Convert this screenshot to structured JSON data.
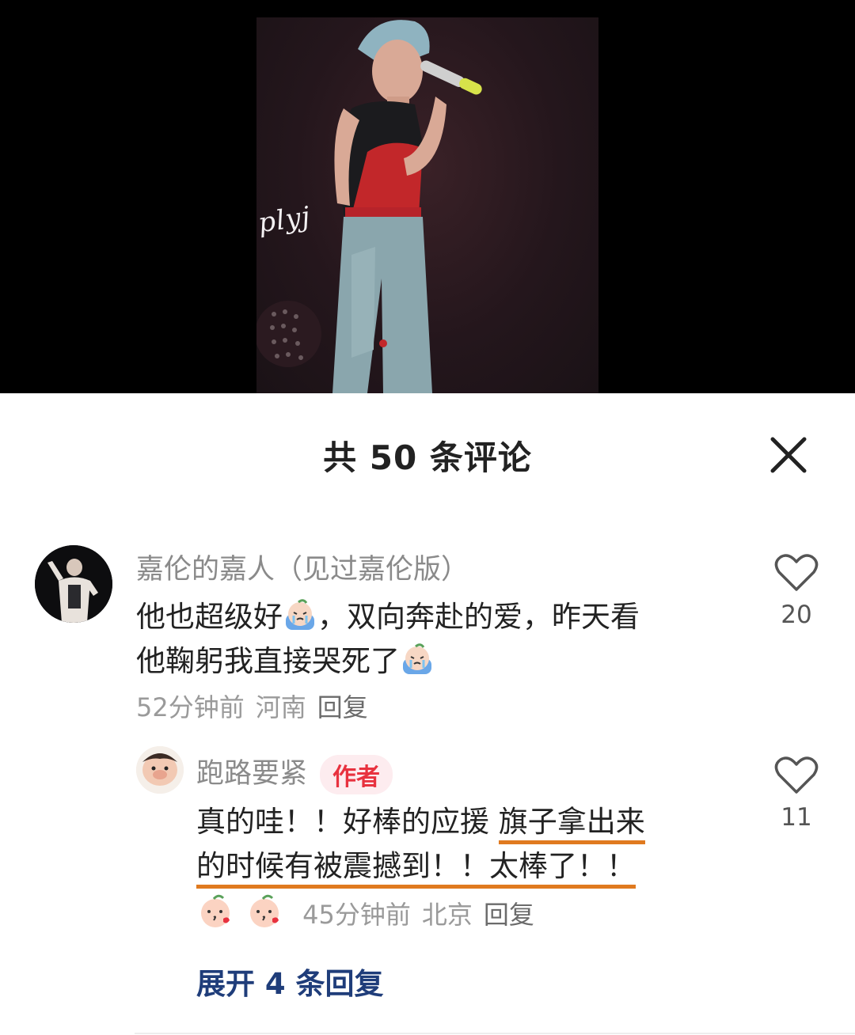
{
  "video": {
    "watermark": "plyj"
  },
  "comments_panel": {
    "title": "共 50 条评论",
    "close_icon": "close-icon"
  },
  "comments": [
    {
      "username": "嘉伦的嘉人（见过嘉伦版）",
      "text_line1_a": "他也超级好",
      "text_line1_b": "，双向奔赴的爱，昨天看",
      "text_line2": "他鞠躬我直接哭死了",
      "emoji": "crying-emoji",
      "time": "52分钟前",
      "location": "河南",
      "reply_label": "回复",
      "likes": "20"
    }
  ],
  "reply": {
    "username": "跑路要紧",
    "badge": "作者",
    "text_line1_plain": "真的哇！！好棒的应援",
    "text_line1_ul": "旗子拿出来",
    "text_line2_ul": "的时候有被震撼到！！太棒了！！",
    "emoji": "kissing-peach-emoji",
    "time": "45分钟前",
    "location": "北京",
    "reply_label": "回复",
    "likes": "11"
  },
  "expand_replies": "展开 4 条回复",
  "colors": {
    "underline": "#e07a1f",
    "author_badge": "#e8323f",
    "expand_link": "#1f3d7a"
  }
}
